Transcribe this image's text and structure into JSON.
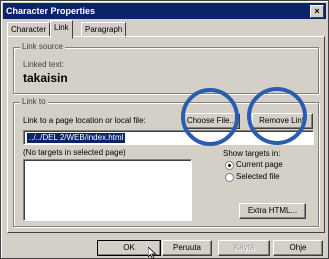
{
  "window": {
    "title": "Character Properties",
    "close_glyph": "×"
  },
  "tabs": [
    {
      "label": "Character",
      "active": false
    },
    {
      "label": "Link",
      "active": true
    },
    {
      "label": "Paragraph",
      "active": false
    }
  ],
  "link_source": {
    "group_label": "Link source",
    "linked_text_label": "Linked text:",
    "linked_text_value": "takaisin"
  },
  "link_to": {
    "group_label": "Link to",
    "location_label": "Link to a page location or local file:",
    "location_value": "../../DEL 2/WEB/index.html",
    "choose_file": "Choose File...",
    "remove_link": "Remove Link",
    "targets_label": "(No targets in selected page)",
    "show_targets_label": "Show targets in:",
    "radio_current": "Current page",
    "radio_selected": "Selected file",
    "extra_html": "Extra HTML..."
  },
  "footer": {
    "ok": "OK",
    "cancel": "Peruuta",
    "apply": "Käytä",
    "help": "Ohje"
  },
  "colors": {
    "title_bar": "#0a246a",
    "highlight_circle": "#2a5db0"
  },
  "icons": {
    "close": "close-icon",
    "cursor": "mouse-pointer-icon"
  }
}
